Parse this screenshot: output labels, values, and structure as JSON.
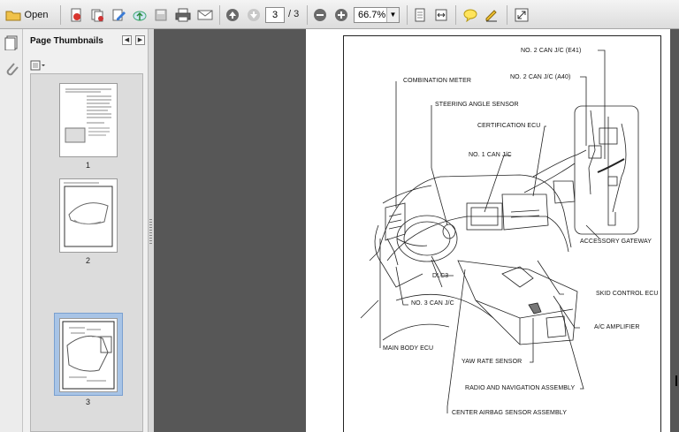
{
  "toolbar": {
    "open_label": "Open",
    "current_page": "3",
    "page_total": "/ 3",
    "zoom_value": "66.7%"
  },
  "panel": {
    "title": "Page Thumbnails",
    "thumbnails": [
      {
        "label": "1"
      },
      {
        "label": "2"
      },
      {
        "label": "3"
      }
    ]
  },
  "diagram": {
    "labels": {
      "can_jc_e41": "NO. 2 CAN J/C (E41)",
      "can_jc_a40": "NO. 2 CAN J/C (A40)",
      "combination_meter": "COMBINATION METER",
      "steering_angle": "STEERING ANGLE SENSOR",
      "certification_ecu": "CERTIFICATION ECU",
      "no1_can": "NO. 1 CAN J/C",
      "accessory_gateway": "ACCESSORY GATEWAY",
      "dlc3": "DLC3",
      "skid_control": "SKID CONTROL ECU",
      "no3_can": "NO. 3 CAN J/C",
      "ac_amplifier": "A/C AMPLIFIER",
      "main_body": "MAIN BODY ECU",
      "yaw_rate": "YAW RATE SENSOR",
      "radio_nav": "RADIO AND NAVIGATION ASSEMBLY",
      "airbag": "CENTER AIRBAG SENSOR ASSEMBLY"
    }
  },
  "colors": {
    "doc_background": "#575757",
    "selection": "#a8c4e6"
  },
  "icons": [
    "open-folder-icon",
    "create-pdf-icon",
    "combine-icon",
    "edit-icon",
    "upload-icon",
    "save-icon",
    "print-icon",
    "email-icon",
    "prev-page-icon",
    "next-page-icon",
    "zoom-out-icon",
    "zoom-in-icon",
    "fit-page-icon",
    "fit-width-icon",
    "comment-icon",
    "sign-icon",
    "fullscreen-icon"
  ]
}
